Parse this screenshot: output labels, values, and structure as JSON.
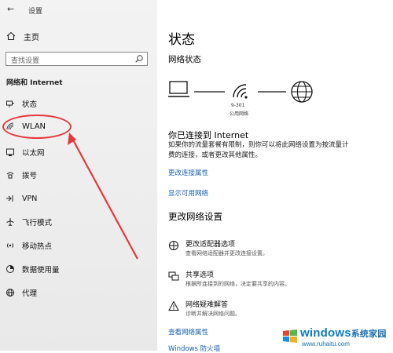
{
  "window": {
    "title": "设置"
  },
  "sidebar": {
    "home_label": "主页",
    "search_placeholder": "查找设置",
    "category": "网络和 Internet",
    "items": [
      {
        "label": "状态",
        "icon": "home-network-icon"
      },
      {
        "label": "WLAN",
        "icon": "wifi-icon",
        "selected": true
      },
      {
        "label": "以太网",
        "icon": "ethernet-icon"
      },
      {
        "label": "拨号",
        "icon": "dialup-icon"
      },
      {
        "label": "VPN",
        "icon": "vpn-icon"
      },
      {
        "label": "飞行模式",
        "icon": "airplane-icon"
      },
      {
        "label": "移动热点",
        "icon": "hotspot-icon"
      },
      {
        "label": "数据使用量",
        "icon": "data-usage-icon"
      },
      {
        "label": "代理",
        "icon": "globe-icon"
      }
    ]
  },
  "main": {
    "title": "状态",
    "network_status_heading": "网络状态",
    "network_name": "9-301",
    "network_type": "公用网络",
    "connected_text": "你已连接到 Internet",
    "description": "如果你的流量套餐有限制，则你可以将此网络设置为按流量计费的连接，或者更改其他属性。",
    "links": {
      "change_properties": "更改连接属性",
      "show_available": "显示可用网络",
      "view_hardware": "查看网络属性",
      "firewall": "Windows 防火墙"
    },
    "change_heading": "更改网络设置",
    "options": [
      {
        "title": "更改适配器选项",
        "desc": "查看网络适配器并更改连接设置。",
        "icon": "adapter-icon"
      },
      {
        "title": "共享选项",
        "desc": "根据所连接到的网络，决定要共享的内容。",
        "icon": "sharing-icon"
      },
      {
        "title": "网络疑难解答",
        "desc": "诊断并解决网络问题。",
        "icon": "warning-icon"
      }
    ]
  },
  "watermark": {
    "text": "windows",
    "text_cn": "系统家园",
    "url": "www.ruhaitu.com"
  },
  "colors": {
    "accent": "#1a5fb4",
    "annotation": "#e4393c"
  }
}
